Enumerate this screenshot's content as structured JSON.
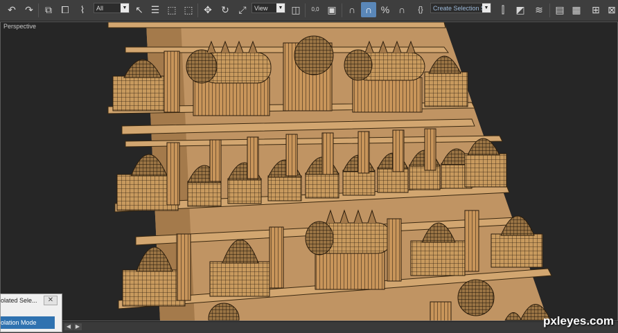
{
  "toolbar": {
    "filter_select": "All",
    "coord_select": "View",
    "selection_set": "Create Selection Se",
    "spinner_label": "0,0"
  },
  "viewport": {
    "label": "Perspective"
  },
  "isolate_panel": {
    "title": "olated Sele...",
    "button": "olation Mode"
  },
  "watermark": "pxleyes.com"
}
